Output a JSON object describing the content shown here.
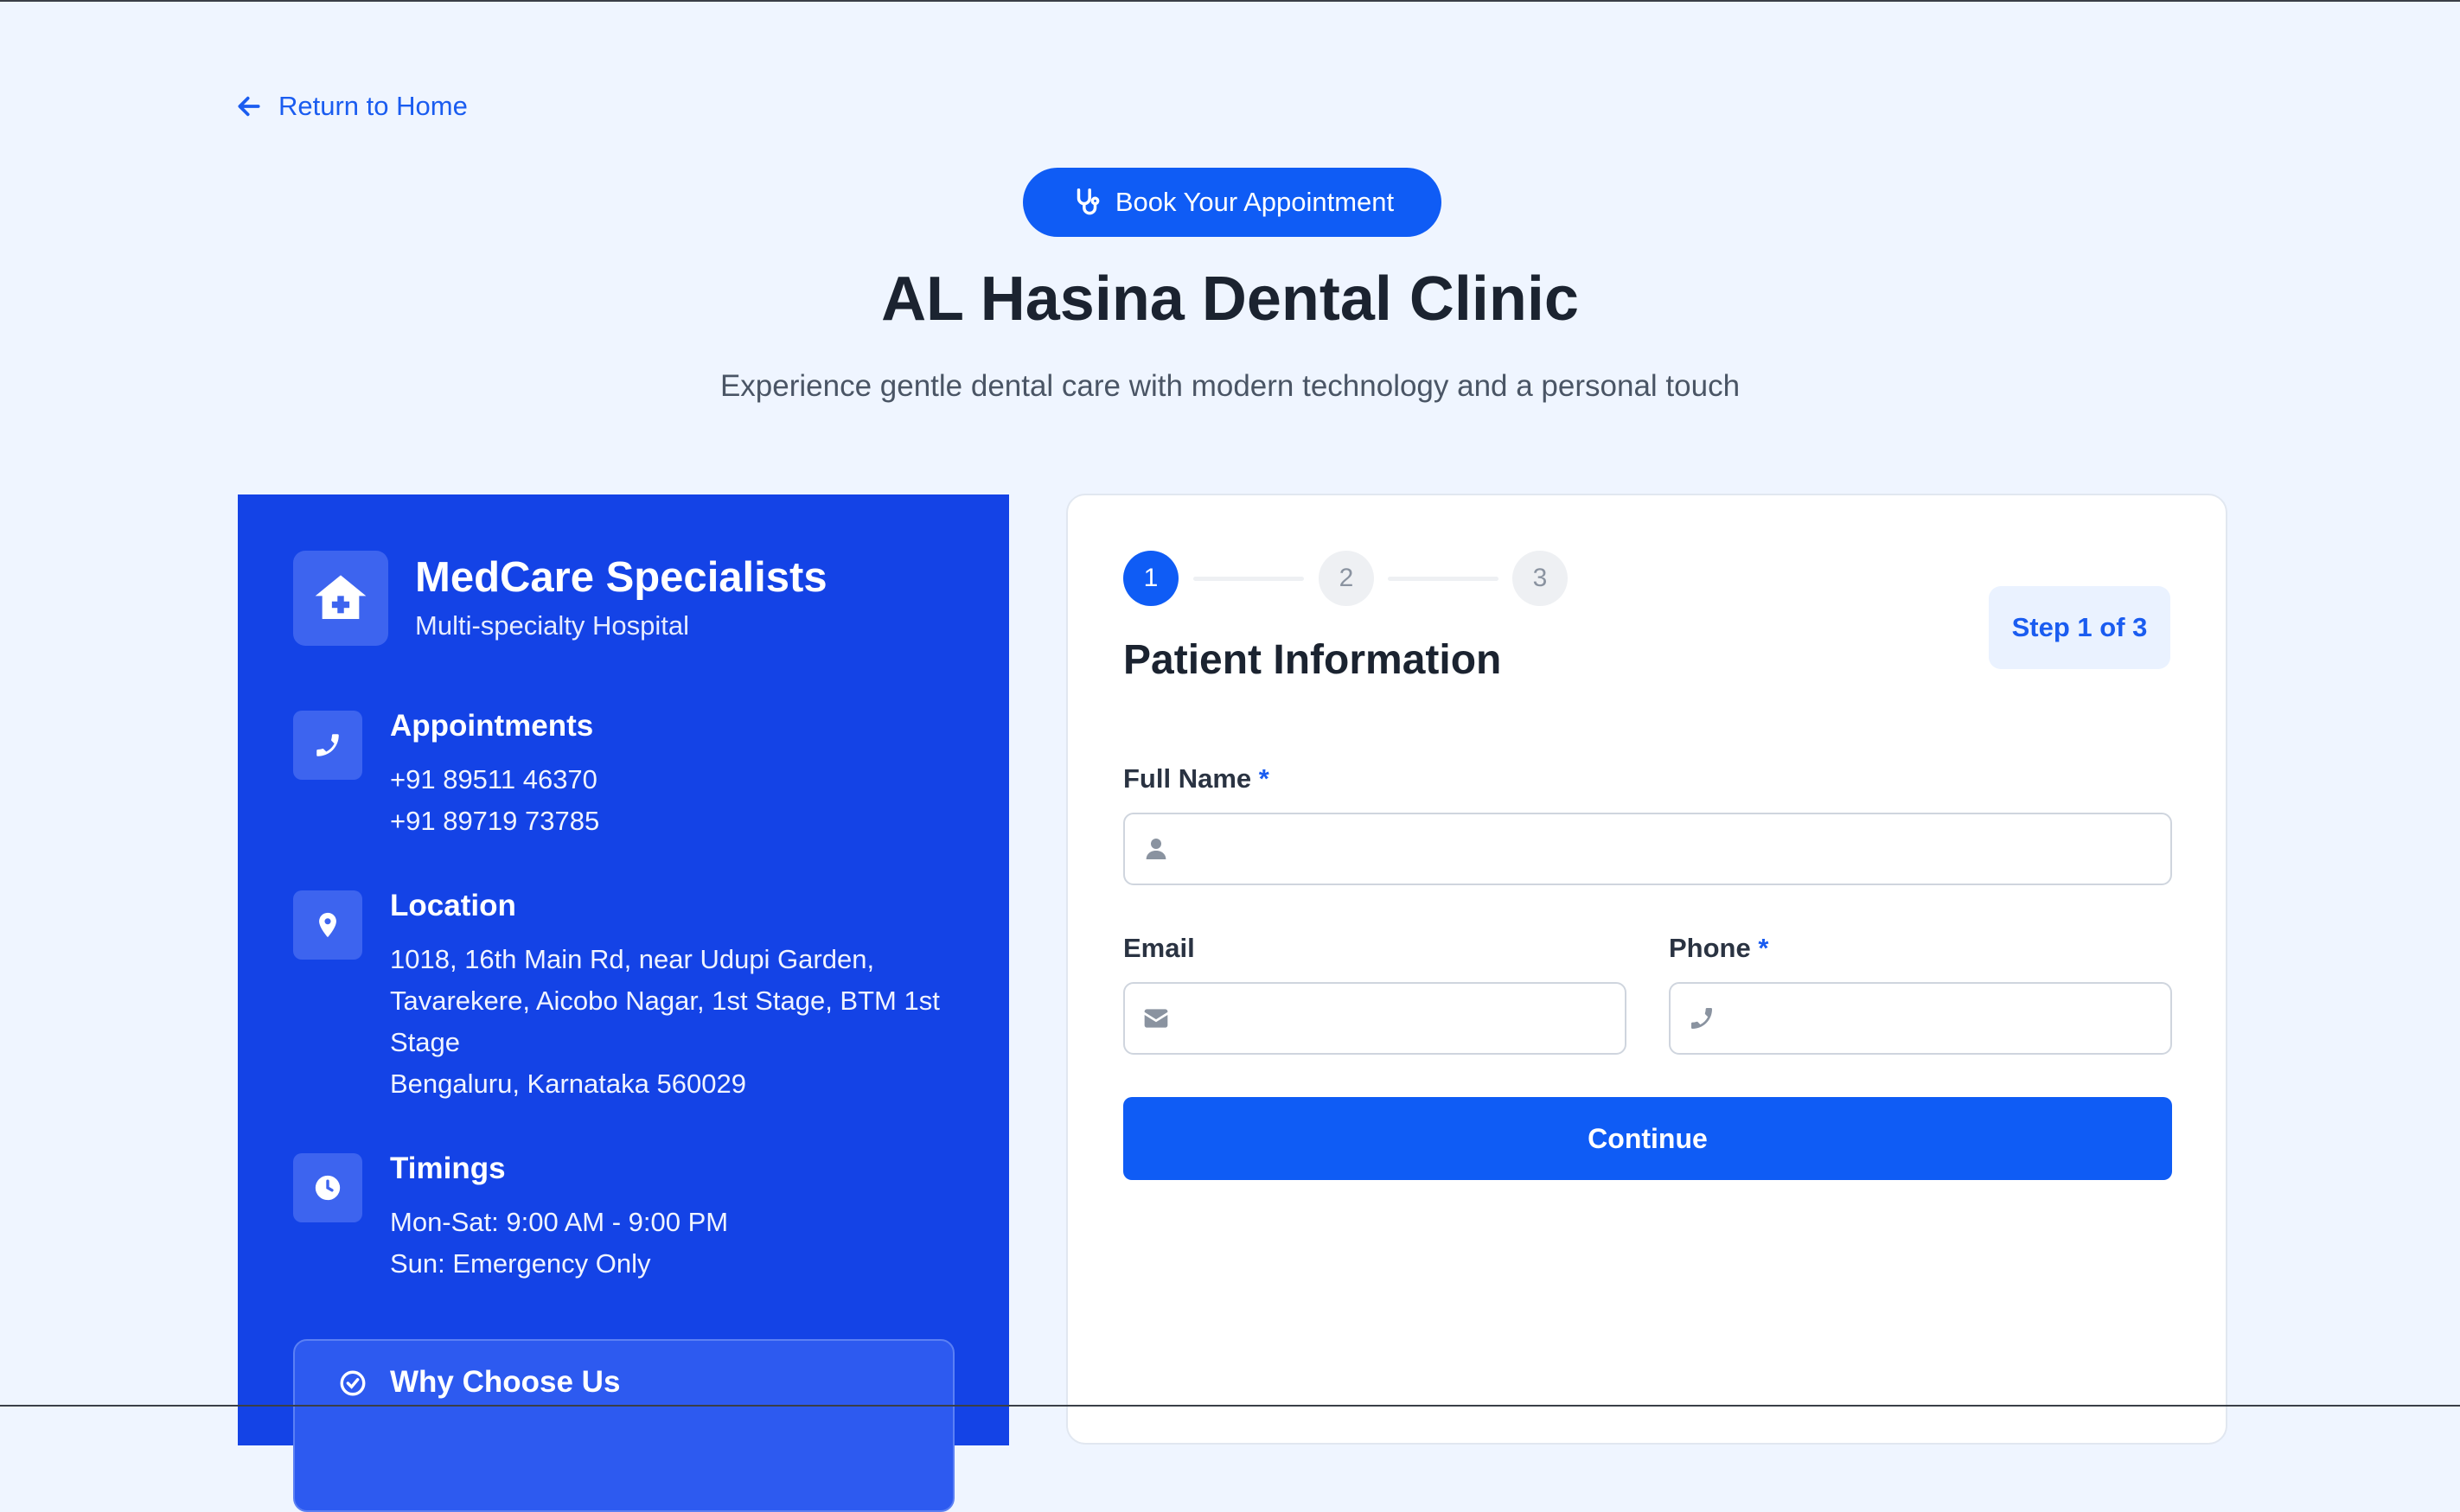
{
  "nav": {
    "return_label": "Return to Home"
  },
  "hero": {
    "badge_label": "Book Your Appointment",
    "title": "AL Hasina Dental Clinic",
    "subtitle": "Experience gentle dental care with modern technology and a personal touch"
  },
  "info": {
    "brand_name": "MedCare Specialists",
    "brand_sub": "Multi-specialty Hospital",
    "appointments": {
      "heading": "Appointments",
      "lines": [
        "+91 89511 46370",
        "+91 89719 73785"
      ]
    },
    "location": {
      "heading": "Location",
      "lines": [
        "1018, 16th Main Rd, near Udupi Garden,",
        "Tavarekere, Aicobo Nagar, 1st Stage, BTM 1st",
        "Stage",
        "Bengaluru, Karnataka 560029"
      ]
    },
    "timings": {
      "heading": "Timings",
      "lines": [
        "Mon-Sat: 9:00 AM - 9:00 PM",
        "Sun: Emergency Only"
      ]
    },
    "why_title": "Why Choose Us"
  },
  "form": {
    "steps": [
      "1",
      "2",
      "3"
    ],
    "current_step": 1,
    "step_badge": "Step 1 of 3",
    "heading": "Patient Information",
    "full_name_label": "Full Name",
    "email_label": "Email",
    "phone_label": "Phone",
    "required_mark": "*",
    "full_name_value": "",
    "email_value": "",
    "phone_value": "",
    "continue_label": "Continue"
  },
  "colors": {
    "primary": "#0f5cf5",
    "panel": "#1443e6",
    "background": "#eff5ff"
  }
}
